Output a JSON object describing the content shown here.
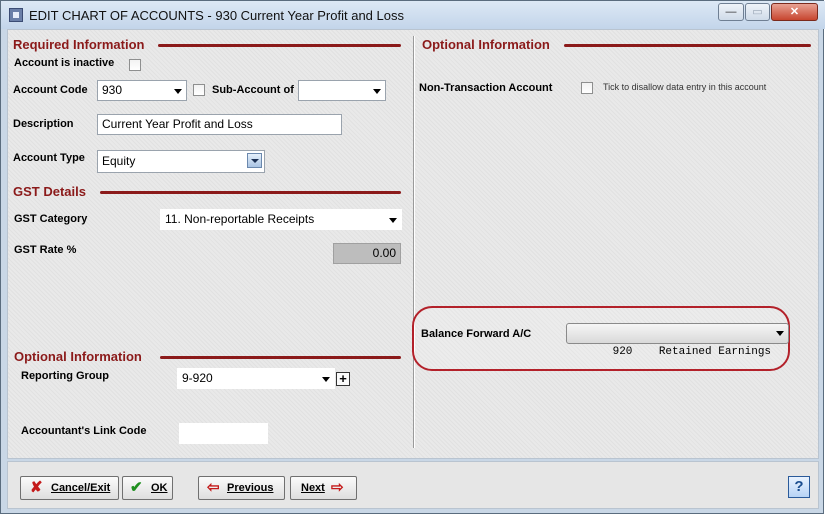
{
  "window": {
    "title": "EDIT CHART OF ACCOUNTS - 930 Current Year Profit and Loss",
    "controls": {
      "minimize": "—",
      "maximize": "▭",
      "close": "✕"
    }
  },
  "required": {
    "title": "Required Information",
    "inactive_label": "Account is inactive",
    "account_code_label": "Account Code",
    "account_code_value": "930",
    "sub_account_label": "Sub-Account of",
    "sub_account_value": "",
    "description_label": "Description",
    "description_value": "Current Year Profit and Loss",
    "account_type_label": "Account Type",
    "account_type_value": "Equity"
  },
  "gst": {
    "title": "GST Details",
    "category_label": "GST Category",
    "category_value": "11. Non-reportable Receipts",
    "rate_label": "GST Rate %",
    "rate_value": "0.00"
  },
  "optional_left": {
    "title": "Optional Information",
    "reporting_group_label": "Reporting Group",
    "reporting_group_value": "9-920",
    "add_symbol": "+",
    "link_code_label": "Accountant's Link Code",
    "link_code_value": ""
  },
  "optional_right": {
    "title": "Optional Information",
    "non_transaction_label": "Non-Transaction Account",
    "non_transaction_hint": "Tick to disallow data entry in this account",
    "balance_forward_label": "Balance Forward A/C",
    "balance_forward_value": "920    Retained Earnings"
  },
  "footer": {
    "cancel_label": "Cancel/Exit",
    "ok_label": "OK",
    "previous_label": "Previous",
    "next_label": "Next",
    "help_label": "?"
  },
  "colors": {
    "section_accent": "#8b1a1a",
    "highlight_ring": "#b3212a"
  }
}
